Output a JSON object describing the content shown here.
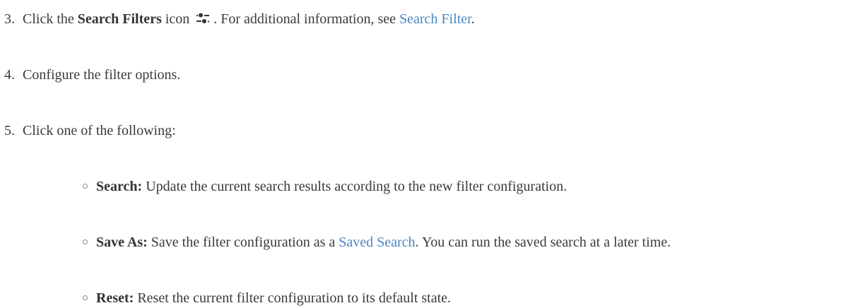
{
  "steps": [
    {
      "number": "3.",
      "prefix": "Click the ",
      "bold": "Search Filters",
      "after_bold": " icon",
      "icon": "search-filters-icon",
      "after_icon": ". For additional information, see ",
      "link": "Search Filter",
      "suffix": "."
    },
    {
      "number": "4.",
      "text": "Configure the filter options."
    },
    {
      "number": "5.",
      "text": "Click one of the following:"
    }
  ],
  "options": [
    {
      "label": "Search:",
      "text": " Update the current search results according to the new filter configuration."
    },
    {
      "label": "Save As:",
      "text_before": " Save the filter configuration as a ",
      "link": "Saved Search",
      "text_after": ". You can run the saved search at a later time."
    },
    {
      "label": "Reset:",
      "text": " Reset the current filter configuration to its default state."
    }
  ],
  "colors": {
    "text": "#3a3a3a",
    "link": "#4a86c0",
    "bullet": "#8a8a8a"
  }
}
